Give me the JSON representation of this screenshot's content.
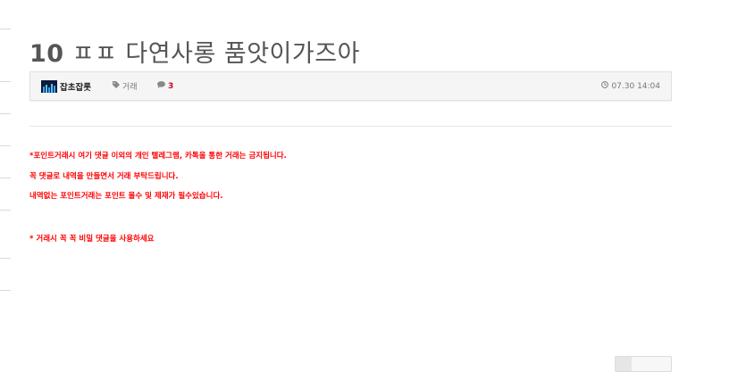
{
  "post": {
    "title_number": "10",
    "title_text": "ㅍㅍ 다연사롱 품앗이가즈아"
  },
  "meta": {
    "author": "잡초잡롯",
    "category": "거래",
    "comment_count": "3",
    "datetime": "07.30 14:04",
    "icons": {
      "author": "avatar",
      "category": "tag-icon",
      "comments": "comment-icon",
      "datetime": "clock-icon"
    }
  },
  "notices": [
    "*포인트거래시 여기 댓글 이외의 개인 텔레그램, 카톡을 통한 거래는 금지됩니다.",
    "꼭 댓글로 내역을 만들면서 거래 부탁드립니다.",
    "내역없는 포인트거래는 포인트 몰수 및 제재가 필수있습니다.",
    "* 거래시 꼭 꼭 비밀 댓글을 사용하세요"
  ],
  "colors": {
    "notice": "#ff0000",
    "title": "#555555",
    "comment_count": "#d0021b"
  }
}
